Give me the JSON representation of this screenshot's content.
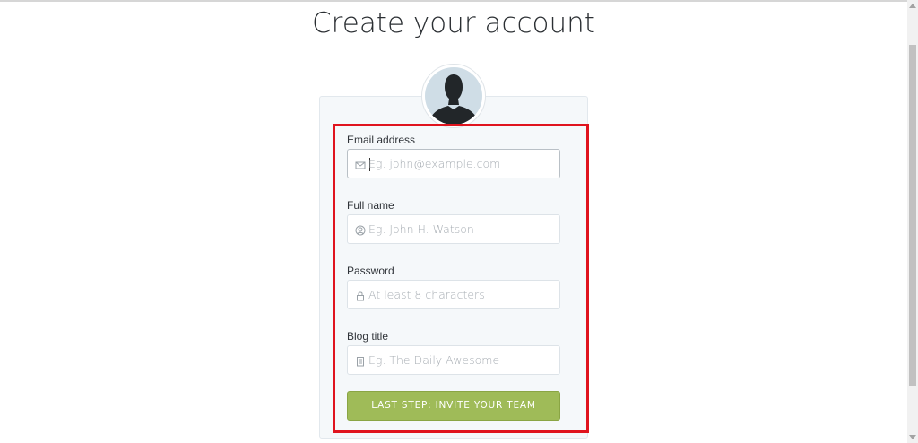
{
  "page": {
    "title": "Create your account"
  },
  "form": {
    "email": {
      "label": "Email address",
      "placeholder": "Eg. john@example.com",
      "icon": "envelope-icon"
    },
    "full_name": {
      "label": "Full name",
      "placeholder": "Eg. John H. Watson",
      "icon": "user-icon"
    },
    "password": {
      "label": "Password",
      "placeholder": "At least 8 characters",
      "icon": "lock-icon"
    },
    "blog_title": {
      "label": "Blog title",
      "placeholder": "Eg. The Daily Awesome",
      "icon": "book-icon"
    },
    "submit_label": "LAST STEP: INVITE YOUR TEAM"
  },
  "colors": {
    "accent_button": "#9fbb58",
    "highlight_box": "#e0141e",
    "card_background": "#f5f8fa"
  }
}
